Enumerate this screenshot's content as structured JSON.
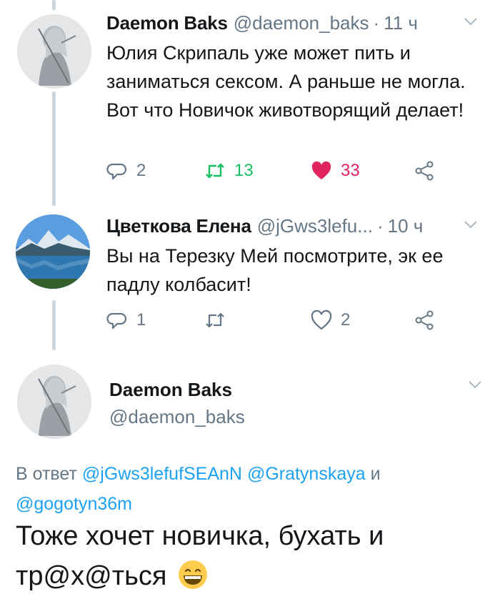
{
  "tweet1": {
    "name": "Daemon Baks",
    "handle": "@daemon_baks",
    "dot": "·",
    "time": "11 ч",
    "text": "Юлия Скрипаль уже может пить и заниматься сексом. А раньше не могла. Вот что Новичок животворящий делает!",
    "replies": "2",
    "retweets": "13",
    "likes": "33",
    "liked": true,
    "retweeted": true
  },
  "tweet2": {
    "name": "Цветкова Елена",
    "handle": "@jGws3lefu...",
    "dot": "·",
    "time": "10 ч",
    "text": "Вы на Терезку Мей посмотрите, эк ее падлу колбасит!",
    "replies": "1",
    "retweets": "",
    "likes": "2"
  },
  "main_tweet": {
    "name": "Daemon Baks",
    "handle": "@daemon_baks",
    "reply_prefix": "В ответ",
    "mention1": "@jGws3lefufSEAnN",
    "mention2": "@Gratynskaya",
    "reply_and": "и",
    "mention3": "@gogotyn36m",
    "text": "Тоже хочет новичка, бухать и тр@х@ться",
    "emoji": "grinning-face-emoji"
  },
  "icons": {
    "reply": "reply-icon",
    "retweet": "retweet-icon",
    "like": "heart-icon",
    "share": "share-icon",
    "caret": "chevron-down-icon"
  },
  "colors": {
    "text": "#14171a",
    "secondary": "#657786",
    "link": "#1da1f2",
    "retweet": "#17bf63",
    "like": "#e0245e",
    "thread_line": "#ccd6dd"
  }
}
